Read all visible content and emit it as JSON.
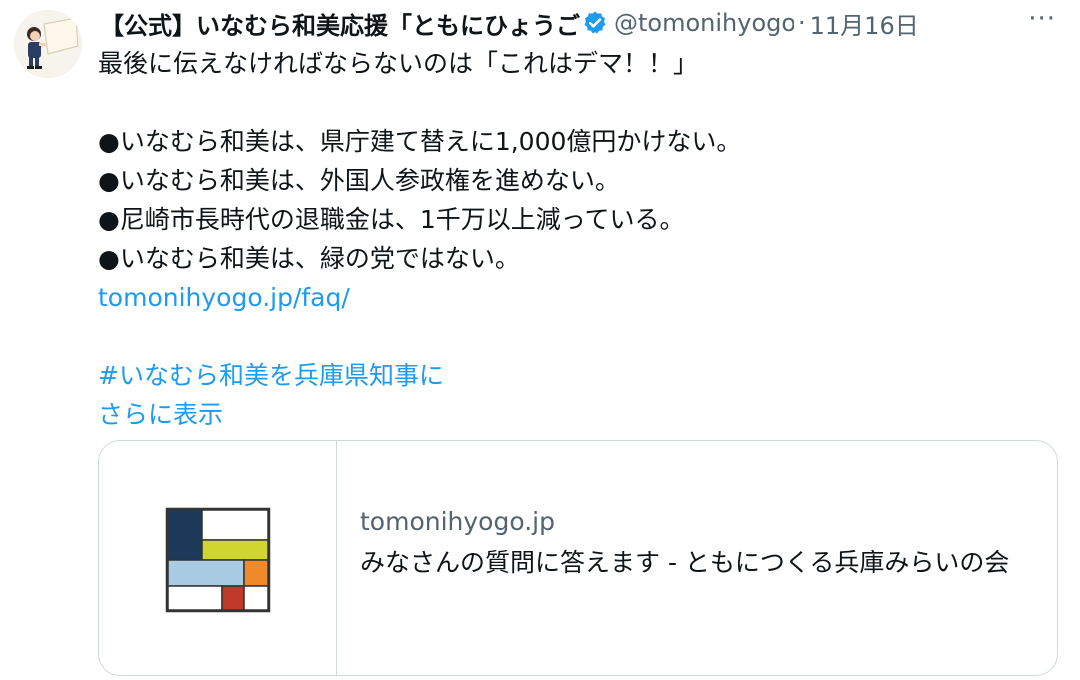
{
  "tweet": {
    "display_name": "【公式】いなむら和美応援「ともにひょうご",
    "handle": "@tomonihyogo",
    "separator": "·",
    "date": "11月16日",
    "more": "···",
    "verified_icon": "verified-badge-icon",
    "lines": [
      "最後に伝えなければならないのは「これはデマ！！」",
      "●いなむら和美は、県庁建て替えに1,000億円かけない。",
      "●いなむら和美は、外国人参政権を進めない。",
      "●尼崎市長時代の退職金は、1千万以上減っている。",
      "●いなむら和美は、緑の党ではない。"
    ],
    "link_url": "tomonihyogo.jp/faq/",
    "hashtag": "#いなむら和美を兵庫県知事に",
    "show_more": "さらに表示"
  },
  "card": {
    "domain": "tomonihyogo.jp",
    "title": "みなさんの質問に答えます - ともにつくる兵庫みらいの会"
  },
  "colors": {
    "link": "#1d9bf0",
    "secondary_text": "#536471",
    "border": "#cfd9de",
    "logo_navy": "#1e3a5a",
    "logo_yellow": "#cfd62e",
    "logo_lightblue": "#a9cbe3",
    "logo_orange": "#ef8a2c",
    "logo_red": "#c0392b"
  }
}
